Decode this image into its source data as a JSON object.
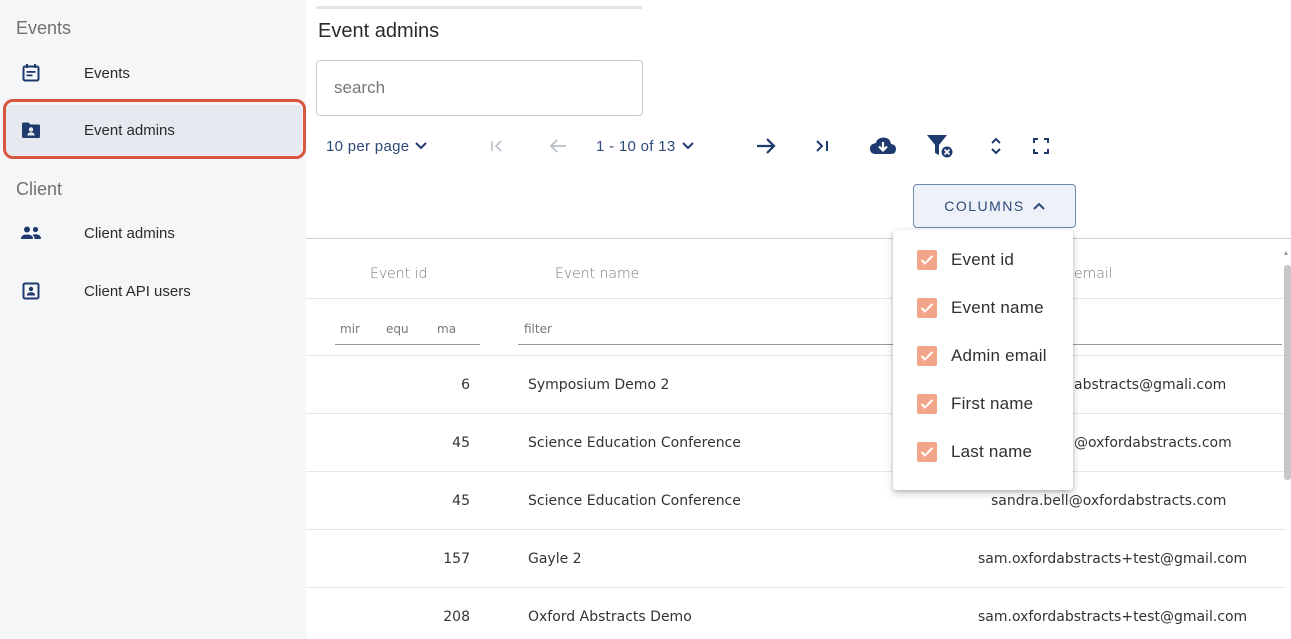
{
  "sidebar": {
    "sections": [
      {
        "title": "Events",
        "items": [
          {
            "label": "Events",
            "icon": "calendar-icon"
          },
          {
            "label": "Event admins",
            "icon": "admin-folder-icon",
            "active": true
          }
        ]
      },
      {
        "title": "Client",
        "items": [
          {
            "label": "Client admins",
            "icon": "people-icon"
          },
          {
            "label": "Client API users",
            "icon": "contact-card-icon"
          }
        ]
      }
    ]
  },
  "main": {
    "title": "Event admins",
    "search_placeholder": "search"
  },
  "toolbar": {
    "per_page": "10 per page",
    "range": "1 - 10 of 13",
    "columns_label": "COLUMNS"
  },
  "table": {
    "headers": [
      "Event id",
      "Event name",
      "email"
    ],
    "filters": {
      "min": "mir",
      "equal": "equ",
      "max": "ma",
      "text": "filter"
    },
    "rows": [
      {
        "id": "6",
        "name": "Symposium Demo 2",
        "email": "abstracts@gmali.com"
      },
      {
        "id": "45",
        "name": "Science Education Conference",
        "email": "@oxfordabstracts.com"
      },
      {
        "id": "45",
        "name": "Science Education Conference",
        "email": "sandra.bell@oxfordabstracts.com"
      },
      {
        "id": "157",
        "name": "Gayle 2",
        "email": "sam.oxfordabstracts+test@gmail.com"
      },
      {
        "id": "208",
        "name": "Oxford Abstracts Demo",
        "email": "sam.oxfordabstracts+test@gmail.com"
      }
    ]
  },
  "columns_menu": {
    "items": [
      {
        "label": "Event id",
        "checked": true
      },
      {
        "label": "Event name",
        "checked": true
      },
      {
        "label": "Admin email",
        "checked": true
      },
      {
        "label": "First name",
        "checked": true
      },
      {
        "label": "Last name",
        "checked": true
      }
    ]
  },
  "colors": {
    "accent": "#1e3a6e",
    "highlight_outline": "#d8563f",
    "checkbox": "#f2a688"
  }
}
